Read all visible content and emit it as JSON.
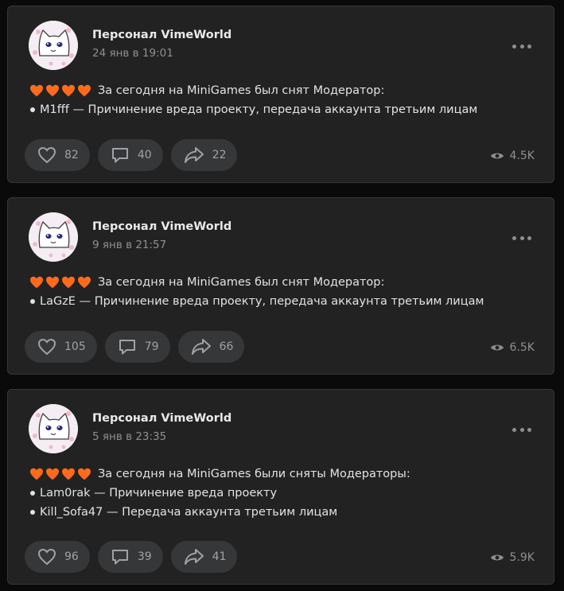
{
  "posts": [
    {
      "author": "Персонал VimeWorld",
      "date": "24 янв в 19:01",
      "headline": "За сегодня на MiniGames был снят Модератор:",
      "entries": [
        "M1fff — Причинение вреда проекту, передача аккаунта третьим лицам"
      ],
      "likes": "82",
      "comments": "40",
      "shares": "22",
      "views": "4.5K"
    },
    {
      "author": "Персонал VimeWorld",
      "date": "9 янв в 21:57",
      "headline": "За сегодня на MiniGames был снят Модератор:",
      "entries": [
        "LaGzE — Причинение вреда проекту, передача аккаунта третьим лицам"
      ],
      "likes": "105",
      "comments": "79",
      "shares": "66",
      "views": "6.5K"
    },
    {
      "author": "Персонал VimeWorld",
      "date": "5 янв в 23:35",
      "headline": "За сегодня на MiniGames были сняты Модераторы:",
      "entries": [
        "Lam0rak — Причинение вреда проекту",
        "Kill_Sofa47 — Передача аккаунта третьим лицам"
      ],
      "likes": "96",
      "comments": "39",
      "shares": "41",
      "views": "5.9K"
    }
  ],
  "colors": {
    "background": "#0a0a0a",
    "card": "#222222",
    "card_border": "#363738",
    "button": "#363738",
    "heart": "#ff6b1a",
    "muted_text": "#8c8f94"
  },
  "icons": {
    "emoji": "orange-heart-icon",
    "like": "heart-outline-icon",
    "comment": "comment-icon",
    "share": "share-arrow-icon",
    "views": "eye-icon",
    "menu": "more-dots-icon"
  }
}
